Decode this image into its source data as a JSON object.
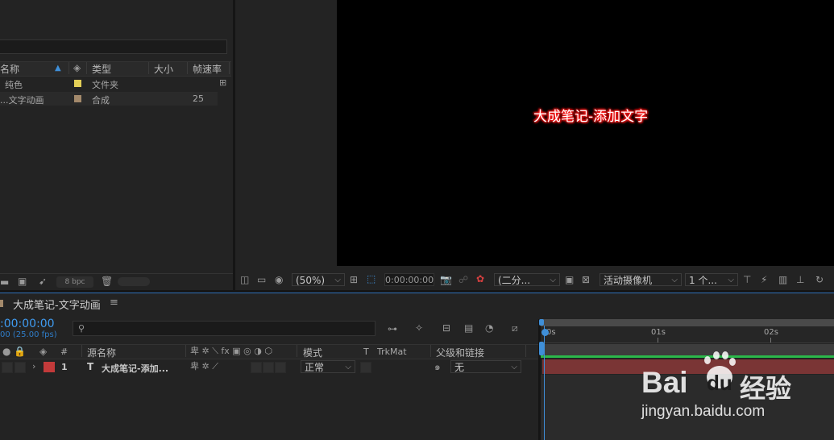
{
  "project": {
    "columns": {
      "name": "名称",
      "type": "类型",
      "size": "大小",
      "fps": "帧速率"
    },
    "items": [
      {
        "name": "纯色",
        "type": "文件夹",
        "fps": "",
        "label_color": "#e3cf57"
      },
      {
        "name": "...文字动画",
        "type": "合成",
        "fps": "25",
        "label_color": "#a3896b"
      }
    ],
    "bpc": "8 bpc"
  },
  "viewer": {
    "text": "大成笔记-添加文字",
    "text_color": "#ff1a1a",
    "zoom": "(50%)",
    "timecode": "0:00:00:00",
    "resolution": "(二分...",
    "camera": "活动摄像机",
    "views": "1 个..."
  },
  "timeline": {
    "comp_tab": "大成笔记-文字动画",
    "menu_glyph": "≡",
    "timecode": ":00:00:00",
    "fps_info": "00 (25.00 fps)",
    "search_placeholder": "",
    "columns": {
      "num": "#",
      "source": "源名称",
      "mode": "模式",
      "t": "T",
      "trkmat": "TrkMat",
      "parent": "父级和链接"
    },
    "layer": {
      "num": "1",
      "type": "T",
      "name": "大成笔记-添加...",
      "mode": "正常",
      "parent": "无",
      "label_color": "#c23a3a"
    },
    "ruler": [
      "0s",
      "01s",
      "02s"
    ],
    "bar_color": "#7a3535",
    "progress_color": "#2bb84a"
  },
  "watermark": {
    "brand_b": "Bai",
    "brand_d": "du",
    "brand_cn": "经验",
    "url": "jingyan.baidu.com"
  }
}
